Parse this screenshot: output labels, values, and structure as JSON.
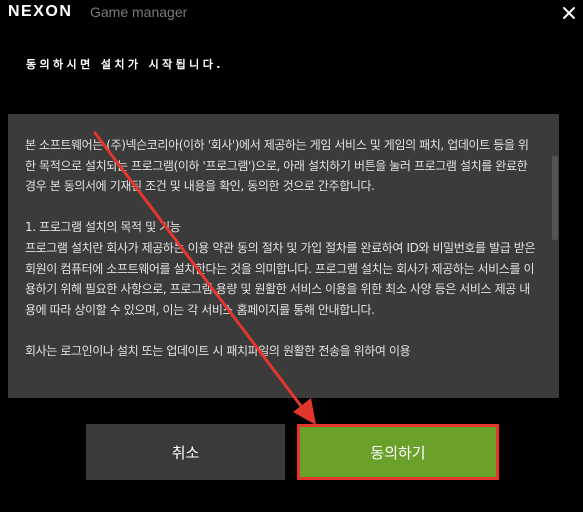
{
  "window": {
    "brand": "NEXON",
    "title": "Game manager"
  },
  "heading": "동의하시면 설치가 시작됩니다.",
  "license": {
    "intro": "본 소프트웨어는 (주)넥슨코리아(이하 '회사')에서 제공하는 게임 서비스 및 게임의 패치, 업데이트 등을 위한 목적으로 설치되는 프로그램(이하 '프로그램')으로, 아래 설치하기 버튼을 눌러 프로그램 설치를 완료한 경우 본 동의서에 기재된 조건 및 내용을 확인, 동의한 것으로 간주합니다.",
    "section1_title": "1. 프로그램 설치의 목적 및 기능",
    "section1_body": "프로그램 설치란 회사가 제공하는 이용 약관 동의 절차 및 가입 절차를 완료하여 ID와 비밀번호를 발급 받은 회원이 컴퓨터에 소프트웨어를 설치한다는 것을 의미합니다. 프로그램 설치는 회사가 제공하는 서비스를 이용하기 위해 필요한 사항으로, 프로그램 용량 및 원활한 서비스 이용을 위한 최소 사양 등은 서비스 제공 내용에 따라 상이할 수 있으며, 이는 각 서비스 홈페이지를 통해 안내합니다.",
    "section1_cont": "회사는 로그인이나 설치 또는 업데이트 시 패치파일의 원활한 전송을 위하여 이용"
  },
  "buttons": {
    "cancel": "취소",
    "agree": "동의하기"
  },
  "colors": {
    "background": "#000000",
    "panel": "#3b3b3b",
    "agree_button": "#6aa12a",
    "highlight_border": "#e3372e",
    "annotation_arrow": "#e3372e"
  },
  "icons": {
    "close": "close-icon"
  }
}
